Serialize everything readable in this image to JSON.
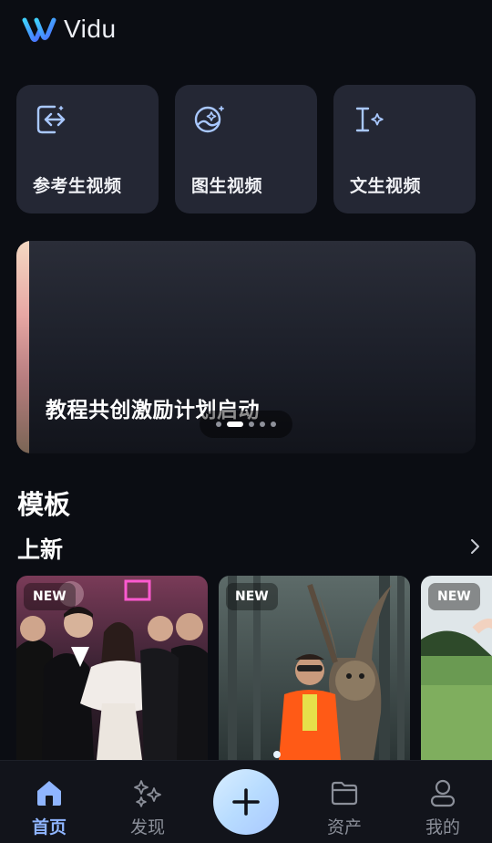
{
  "app": {
    "name": "Vidu"
  },
  "quick_actions": [
    {
      "label": "参考生视频",
      "icon": "reference-video-icon"
    },
    {
      "label": "图生视频",
      "icon": "image-video-icon"
    },
    {
      "label": "文生视频",
      "icon": "text-video-icon"
    }
  ],
  "banner": {
    "title": "教程共创激励计划启动",
    "slide_count": 5,
    "active_slide": 2
  },
  "templates": {
    "section_title": "模板",
    "subsection_title": "上新",
    "more_icon": "chevron-right-icon",
    "cards": [
      {
        "badge": "NEW"
      },
      {
        "badge": "NEW"
      },
      {
        "badge": "NEW"
      }
    ]
  },
  "tabbar": {
    "items": [
      {
        "label": "首页",
        "icon": "home-icon",
        "active": true
      },
      {
        "label": "发现",
        "icon": "sparkle-icon",
        "active": false
      },
      {
        "label": "",
        "icon": "plus-icon",
        "active": false
      },
      {
        "label": "资产",
        "icon": "folder-icon",
        "active": false
      },
      {
        "label": "我的",
        "icon": "user-icon",
        "active": false
      }
    ]
  },
  "colors": {
    "background": "#0b0d13",
    "card": "#242734",
    "accent": "#8fb5ff",
    "icon_blue": "#a9c8ff"
  }
}
